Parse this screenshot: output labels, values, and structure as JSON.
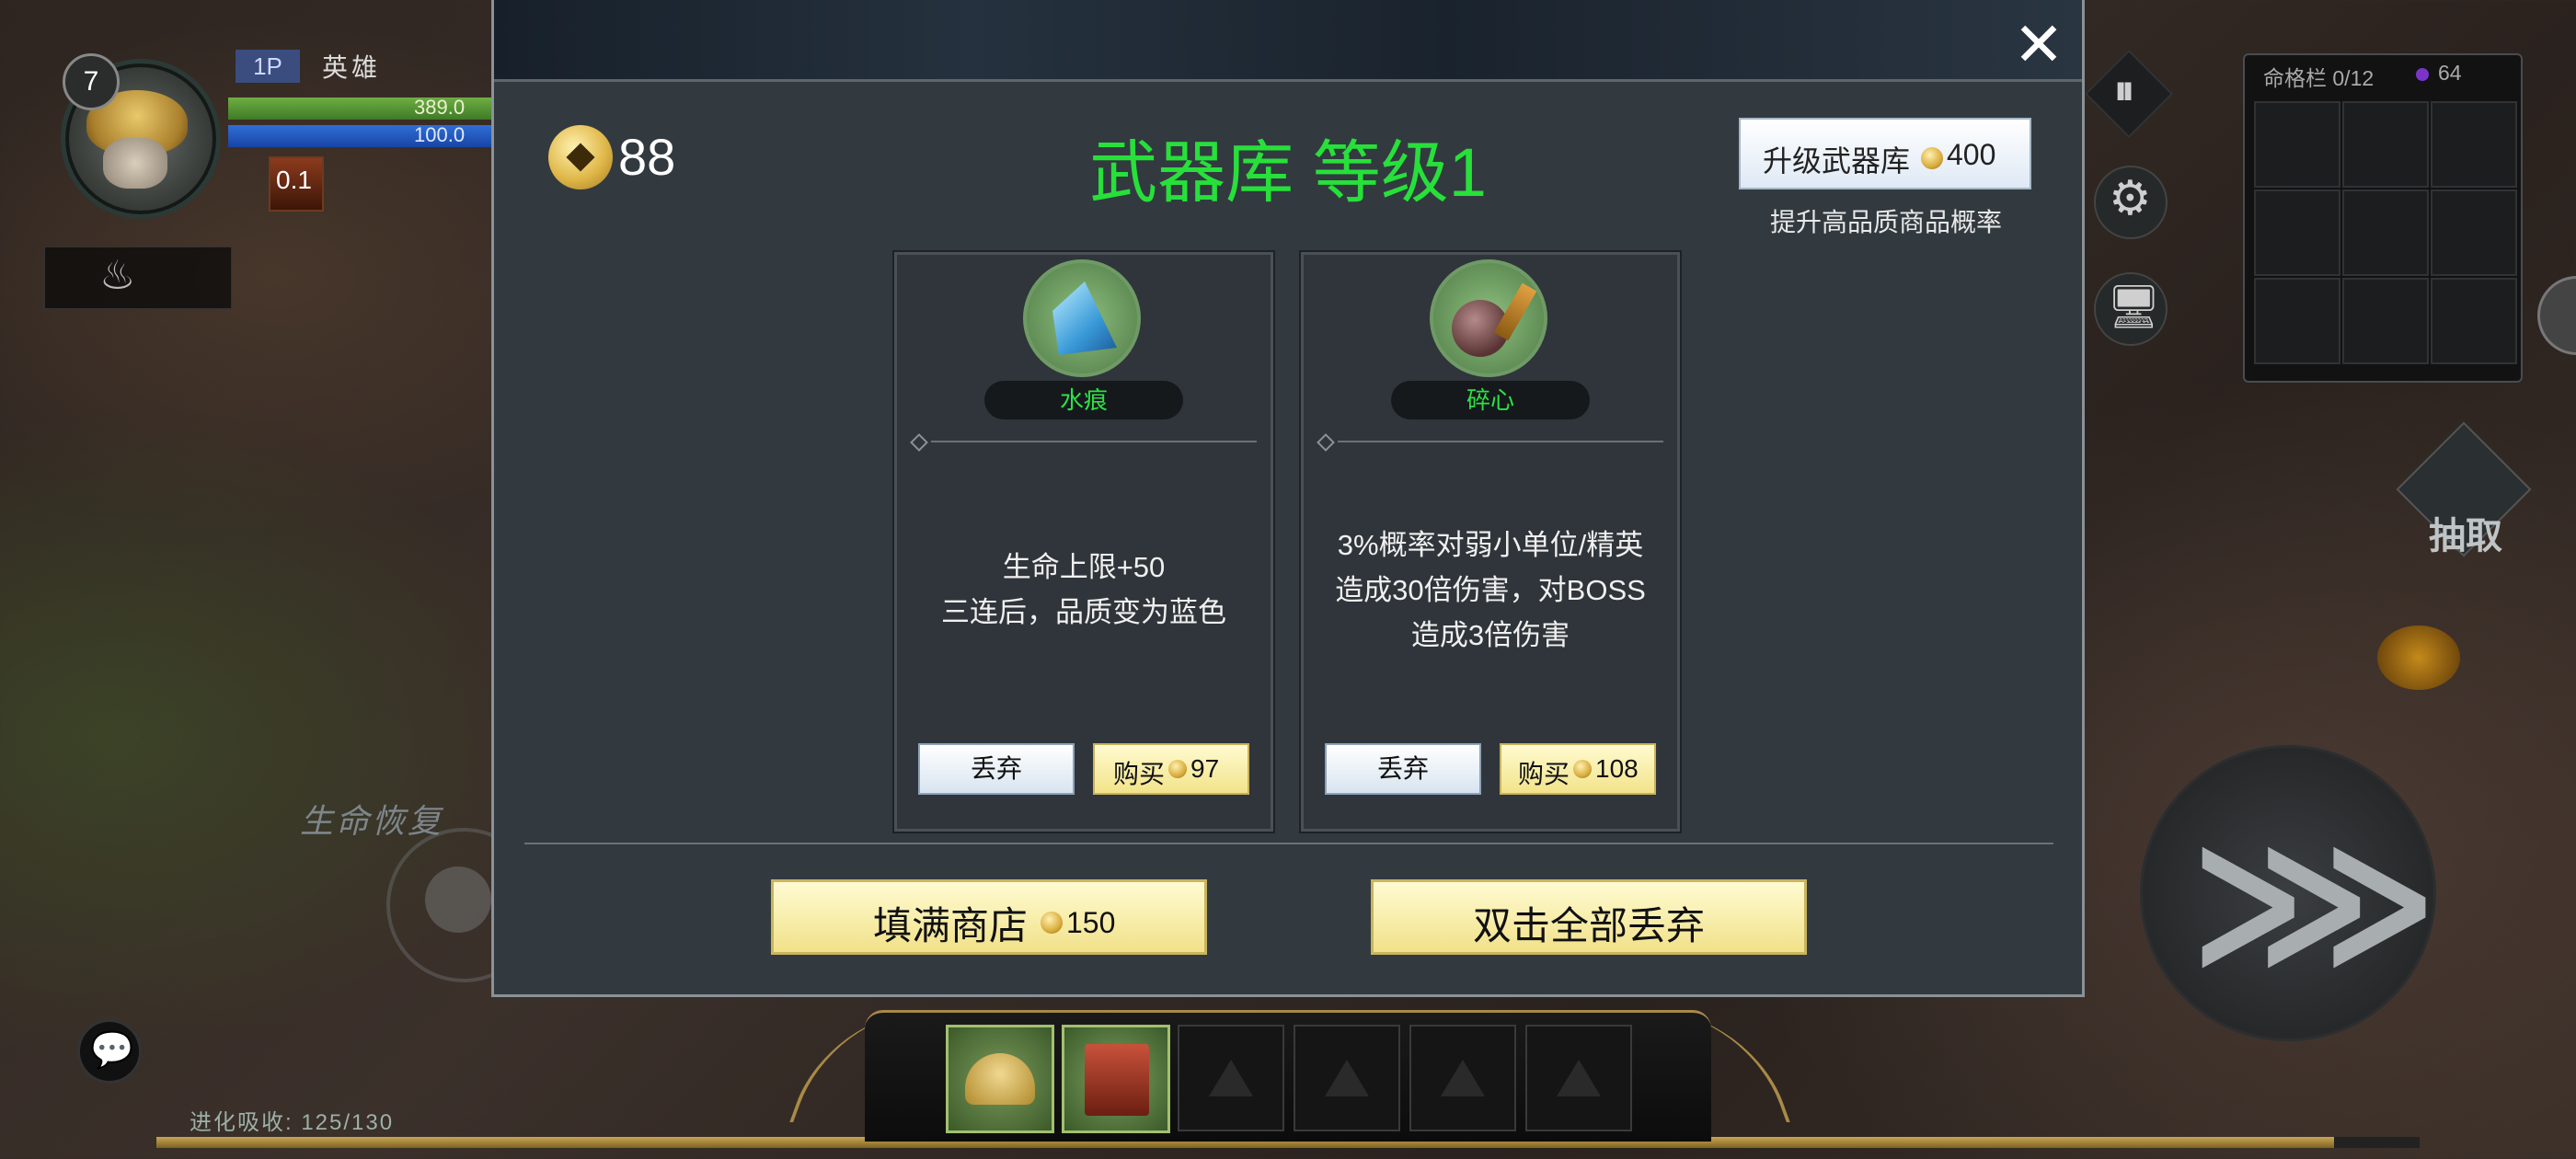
{
  "hud": {
    "level": "7",
    "player_tag": "1P",
    "player_name": "英雄",
    "hp": "389.0",
    "mp": "100.0",
    "buff_value": "0.1",
    "skill_glyph": "♨",
    "regen_label": "生命恢复",
    "evolution": "进化吸收: 125/130",
    "evolution_progress": 0.962
  },
  "fate_panel": {
    "title": "命格栏 0/12",
    "gem_count": "64"
  },
  "right_buttons": {
    "pause_glyph": "⏸",
    "gear_glyph": "⚙",
    "screen_glyph": "🖥",
    "draw_label": "抽取",
    "attack_glyph": "⋙"
  },
  "shop": {
    "coins": "88",
    "title": "武器库 等级1",
    "upgrade_label": "升级武器库",
    "upgrade_cost": "400",
    "upgrade_hint": "提升高品质商品概率",
    "close_glyph": "✕",
    "items": [
      {
        "name": "水痕",
        "icon": "water-crystal-icon",
        "desc": [
          "生命上限+50",
          "三连后，品质变为蓝色"
        ],
        "discard_label": "丢弃",
        "buy_label": "购买",
        "price": "97"
      },
      {
        "name": "碎心",
        "icon": "spiked-mace-icon",
        "desc": [
          "3%概率对弱小单位/精英",
          "造成30倍伤害，对BOSS",
          "造成3倍伤害"
        ],
        "discard_label": "丢弃",
        "buy_label": "购买",
        "price": "108"
      }
    ],
    "fill_label": "填满商店",
    "fill_cost": "150",
    "discard_all_label": "双击全部丢弃"
  },
  "chat_glyph": "💬",
  "colors": {
    "title_green": "#27e03a",
    "name_green": "#2ee045",
    "buy_yellow": "#f2e38a",
    "discard_blue": "#d8e4f0"
  }
}
